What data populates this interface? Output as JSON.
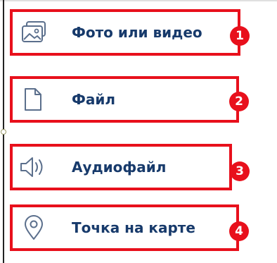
{
  "menu": {
    "items": [
      {
        "label": "Фото или видео",
        "icon": "photo-gallery-icon",
        "badge": "1"
      },
      {
        "label": "Файл",
        "icon": "file-icon",
        "badge": "2"
      },
      {
        "label": "Аудиофайл",
        "icon": "speaker-icon",
        "badge": "3"
      },
      {
        "label": "Точка на карте",
        "icon": "map-pin-icon",
        "badge": "4"
      }
    ]
  },
  "colors": {
    "highlight": "#e8101c",
    "label_text": "#173a6b",
    "icon_stroke": "#5b6f8c"
  }
}
